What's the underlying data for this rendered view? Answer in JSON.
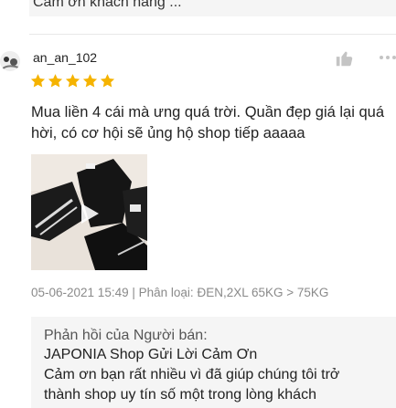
{
  "previous_reply": {
    "text": "Cảm ơn khách hàng ..."
  },
  "review": {
    "username": "an_an_102",
    "rating": 5,
    "text": "Mua liền 4 cái mà ưng quá trời. Quần đẹp giá lại quá hời, có cơ hội sẽ ủng hộ shop tiếp aaaaa",
    "date": "05-06-2021 15:49",
    "separator": "|",
    "variation_label": "Phân loại:",
    "variation_value": "ĐEN,2XL 65KG > 75KG"
  },
  "seller_reply": {
    "label": "Phản hồi của Người bán:",
    "line1": "JAPONIA Shop Gửi Lời Cảm Ơn",
    "line2": "Cảm ơn bạn  rất nhiều vì đã giúp chúng tôi trở",
    "line3": "thành shop uy tín số một trong lòng khách"
  },
  "colors": {
    "star": "#f5b300",
    "accent": "#ee4d2d"
  },
  "icons": {
    "like": "thumbs-up-icon",
    "more": "more-icon",
    "play": "play-icon"
  }
}
